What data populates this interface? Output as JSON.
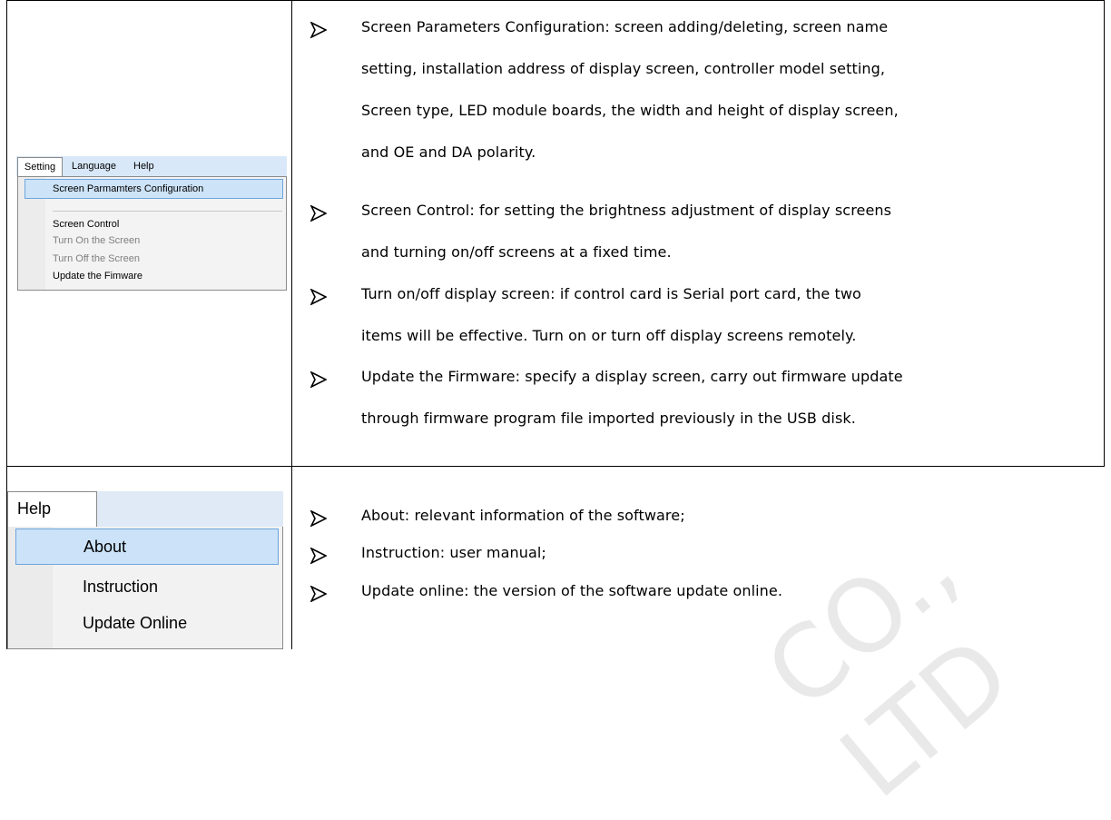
{
  "setting_menu": {
    "tabs": [
      "Setting",
      "Language",
      "Help"
    ],
    "items": [
      {
        "label": "Screen Parmamters Configuration",
        "state": "selected"
      },
      {
        "label": "Screen Control",
        "state": "enabled"
      },
      {
        "label": "Turn On the Screen",
        "state": "disabled"
      },
      {
        "label": "Turn Off the Screen",
        "state": "disabled"
      },
      {
        "label": "Update the Fimware",
        "state": "enabled"
      }
    ]
  },
  "setting_descriptions": [
    {
      "lines": [
        "Screen Parameters Configuration: screen adding/deleting, screen name",
        "setting, installation address of display screen, controller model setting,",
        "Screen type, LED module boards, the width and height of display screen,",
        "and OE and DA polarity."
      ]
    },
    {
      "lines": [
        "Screen Control: for setting the brightness adjustment of display screens",
        "and turning on/off screens at a fixed time."
      ]
    },
    {
      "lines": [
        "Turn on/off display screen: if control card is Serial port card, the two",
        "items will be effective. Turn on or turn off display screens remotely."
      ]
    },
    {
      "lines": [
        "Update the Firmware: specify a display screen, carry out firmware update",
        "through firmware program file imported previously in the USB disk."
      ]
    }
  ],
  "help_menu": {
    "tab": "Help",
    "items": [
      {
        "label": "About",
        "state": "selected"
      },
      {
        "label": "Instruction",
        "state": "enabled"
      },
      {
        "label": "Update Online",
        "state": "enabled"
      }
    ]
  },
  "help_descriptions": [
    "About: relevant information of the software;",
    "Instruction: user manual;",
    "Update online: the version of the software update online."
  ],
  "watermark": "CO., LTD"
}
